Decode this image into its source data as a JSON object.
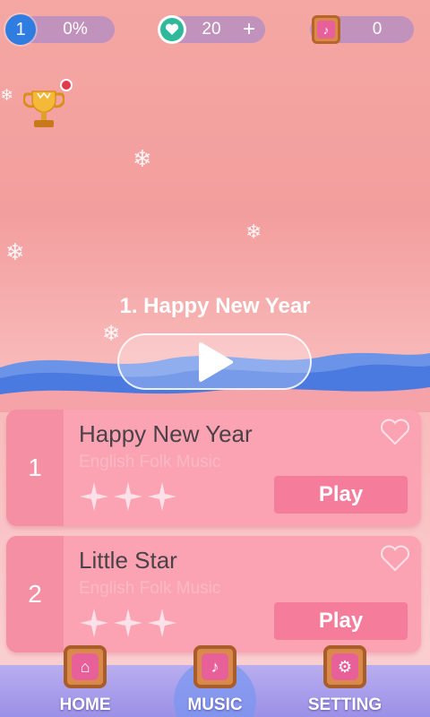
{
  "hud": {
    "level": "1",
    "progress": "0%",
    "hearts": "20",
    "plus": "+",
    "notes": "0"
  },
  "featured": {
    "title": "1. Happy New Year"
  },
  "songs": [
    {
      "number": "1",
      "title": "Happy New Year",
      "subtitle": "English Folk Music",
      "stars": 3,
      "play_label": "Play"
    },
    {
      "number": "2",
      "title": "Little Star",
      "subtitle": "English Folk Music",
      "stars": 3,
      "play_label": "Play"
    }
  ],
  "nav": {
    "home": "HOME",
    "music": "MUSIC",
    "setting": "SETTING"
  },
  "colors": {
    "card": "#fca3b3",
    "card_number_panel": "#f58fa3",
    "play_button": "#f57c9a",
    "wave": "#4a7ae0"
  }
}
